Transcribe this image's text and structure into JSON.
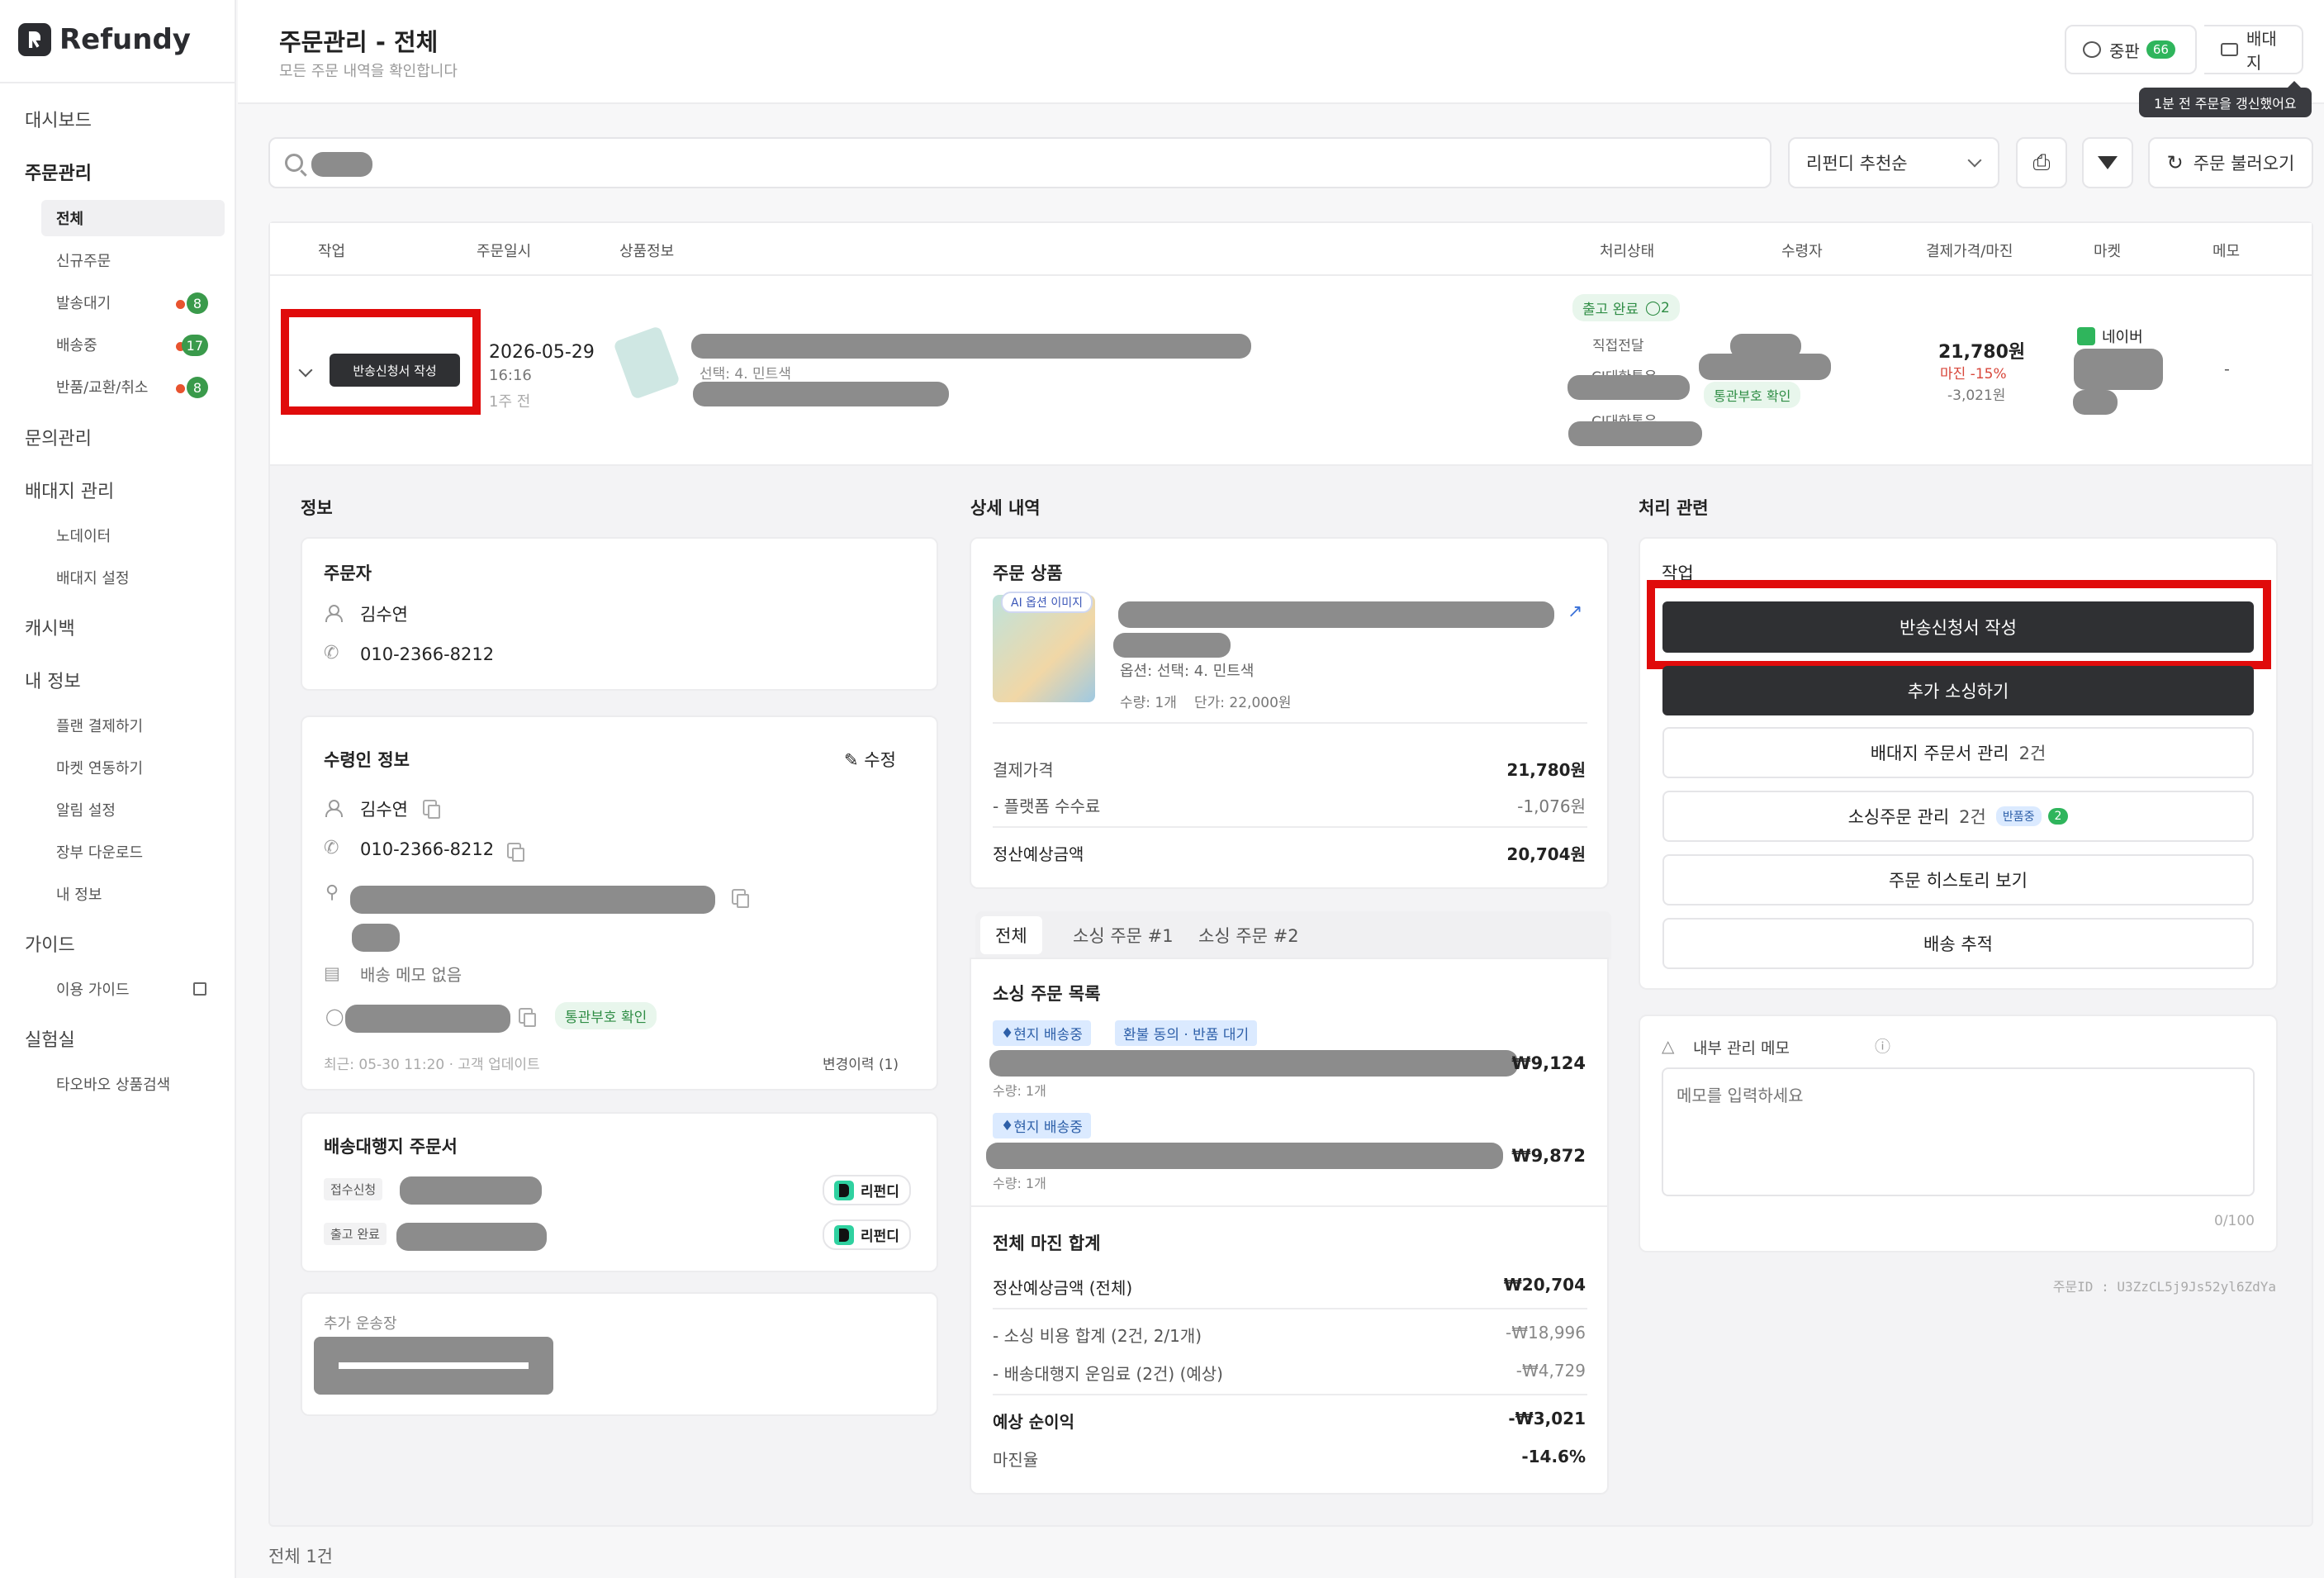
{
  "app": {
    "name": "Refundy"
  },
  "sidebar": {
    "dashboard": "대시보드",
    "orders": "주문관리",
    "orders_items": [
      {
        "label": "전체"
      },
      {
        "label": "신규주문"
      },
      {
        "label": "발송대기",
        "count": "8"
      },
      {
        "label": "배송중",
        "count": "17"
      },
      {
        "label": "반품/교환/취소",
        "count": "8"
      }
    ],
    "inquiry": "문의관리",
    "forwarder": "배대지 관리",
    "forwarder_items": [
      "노데이터",
      "배대지 설정"
    ],
    "cashback": "캐시백",
    "myinfo": "내 정보",
    "myinfo_items": [
      "플랜 결제하기",
      "마켓 연동하기",
      "알림 설정",
      "장부 다운로드",
      "내 정보"
    ],
    "guide": "가이드",
    "guide_items": [
      "이용 가이드"
    ],
    "lab": "실험실",
    "lab_items": [
      "타오바오 상품검색"
    ]
  },
  "header": {
    "title": "주문관리 - 전체",
    "subtitle": "모든 주문 내역을 확인합니다",
    "board_label": "중판",
    "board_count": "66",
    "forwarder_label": "배대지",
    "tooltip": "1분 전 주문을 갱신했어요"
  },
  "toolbar": {
    "sort_label": "리펀디 추천순",
    "reload_label": "주문 불러오기"
  },
  "table": {
    "headers": [
      "작업",
      "주문일시",
      "상품정보",
      "처리상태",
      "수령자",
      "결제가격/마진",
      "마켓",
      "메모"
    ],
    "row": {
      "action": "반송신청서 작성",
      "date": "2026-05-29",
      "time": "16:16",
      "ago": "1주 전",
      "option": "선택: 4. 민트색",
      "status": "출고 완료",
      "status_comments": "2",
      "delivery": "직접전달",
      "courier1": "CJ대한통운",
      "courier2": "CJ대한통운",
      "customs": "통관부호 확인",
      "price": "21,780원",
      "margin": "마진 -15%",
      "margin_amount": "-3,021원",
      "market": "네이버",
      "memo": "-"
    }
  },
  "info": {
    "section": "정보",
    "orderer_title": "주문자",
    "orderer_name": "김수연",
    "orderer_phone": "010-2366-8212",
    "receiver_title": "수령인 정보",
    "edit": "수정",
    "receiver_name": "김수연",
    "receiver_phone": "010-2366-8212",
    "delivery_memo": "배송 메모 없음",
    "customs": "통관부호 확인",
    "updated": "최근: 05-30 11:20 · 고객 업데이트",
    "history": "변경이력 (1)",
    "forwarder_title": "배송대행지 주문서",
    "forwarder_rows": [
      {
        "tag": "접수신청",
        "brand": "리펀디"
      },
      {
        "tag": "출고 완료",
        "brand": "리펀디"
      }
    ],
    "extra_title": "추가 운송장"
  },
  "detail": {
    "section": "상세 내역",
    "product_title": "주문 상품",
    "ai_badge": "AI 옵션 이미지",
    "option": "옵션: 선택: 4. 민트색",
    "qty": "수량: 1개",
    "unit": "단가: 22,000원",
    "pay_label": "결제가격",
    "pay_value": "21,780원",
    "fee_label": "- 플랫폼 수수료",
    "fee_value": "-1,076원",
    "settle_label": "정산예상금액",
    "settle_value": "20,704원",
    "tabs": [
      "전체",
      "소싱 주문 #1",
      "소싱 주문 #2"
    ],
    "sourcing_title": "소싱 주문 목록",
    "sourcing": [
      {
        "tags": [
          "현지 배송중",
          "환불 동의 · 반품 대기"
        ],
        "qty": "수량: 1개",
        "price": "₩9,124"
      },
      {
        "tags": [
          "현지 배송중"
        ],
        "qty": "수량: 1개",
        "price": "₩9,872"
      }
    ],
    "margin_title": "전체 마진 합계",
    "margin_rows": [
      {
        "label": "정산예상금액 (전체)",
        "value": "₩20,704"
      },
      {
        "label": "- 소싱 비용 합계 (2건, 2/1개)",
        "value": "-₩18,996"
      },
      {
        "label": "- 배송대행지 운임료 (2건) (예상)",
        "value": "-₩4,729"
      },
      {
        "label": "예상 순이익",
        "value": "-₩3,021"
      },
      {
        "label": "마진율",
        "value": "-14.6%"
      }
    ]
  },
  "process": {
    "section": "처리 관련",
    "work_title": "작업",
    "return_btn": "반송신청서 작성",
    "add_btn": "추가 소싱하기",
    "fw_orders": "배대지 주문서 관리",
    "fw_count": "2건",
    "src_orders": "소싱주문 관리",
    "src_count": "2건",
    "src_badge": "반품중",
    "src_badge_count": "2",
    "history": "주문 히스토리 보기",
    "track": "배송 추적",
    "memo_title": "내부 관리 메모",
    "memo_placeholder": "메모를 입력하세요",
    "memo_counter": "0/100",
    "order_id": "주문ID : U3ZzCL5j9Js52yl6ZdYa"
  },
  "footer": {
    "total": "전체 1건"
  },
  "colors": {
    "accent": "#2f3033",
    "highlight": "#e00b0b",
    "green": "#2fb55c"
  }
}
